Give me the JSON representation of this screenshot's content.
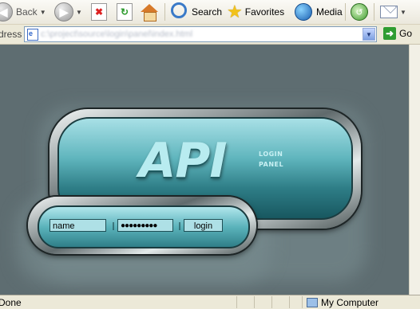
{
  "toolbar": {
    "back_label": "Back",
    "search_label": "Search",
    "favorites_label": "Favorites",
    "media_label": "Media"
  },
  "address_bar": {
    "label": "dress",
    "url": "c:\\project\\source\\login\\panel\\index.html",
    "go_label": "Go"
  },
  "login_panel": {
    "logo_text": "API",
    "logo_subtitle_line1": "LOGIN",
    "logo_subtitle_line2": "PANEL",
    "username_value": "name",
    "password_value": "●●●●●●●●●",
    "login_button_label": "login"
  },
  "status_bar": {
    "status_text": "Done",
    "zone_text": "My Computer"
  },
  "colors": {
    "page_background": "#5e6d71",
    "panel_glass": "#5fb5bd",
    "toolbar_background": "#ece9d8"
  }
}
